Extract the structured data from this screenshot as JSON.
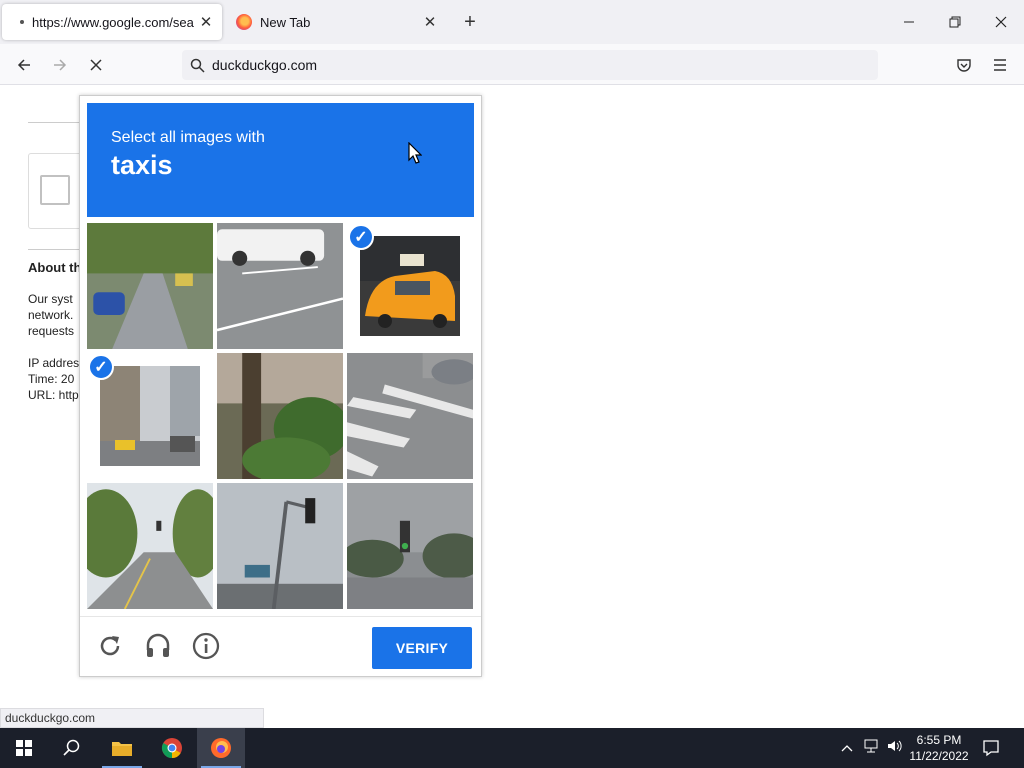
{
  "browser": {
    "tabs": [
      {
        "title": "https://www.google.com/search?q=",
        "active": true
      },
      {
        "title": "New Tab",
        "active": false
      }
    ],
    "new_tab_glyph": "+",
    "url": "duckduckgo.com",
    "status_bar": "duckduckgo.com"
  },
  "background_page": {
    "heading": "About th",
    "paragraph_lines": [
      "Our syst",
      "network.",
      "requests"
    ],
    "info_lines": [
      "IP addres",
      "Time: 20",
      "URL: http"
    ]
  },
  "captcha": {
    "instruction": "Select all images with",
    "keyword": "taxis",
    "tiles": [
      {
        "scene": "tree-lined-street",
        "selected": false
      },
      {
        "scene": "white-pickup-truck",
        "selected": false
      },
      {
        "scene": "yellow-taxi",
        "selected": true
      },
      {
        "scene": "city-street-taxi",
        "selected": true
      },
      {
        "scene": "tree-and-bushes",
        "selected": false
      },
      {
        "scene": "crosswalk",
        "selected": false
      },
      {
        "scene": "road-with-traffic-light",
        "selected": false
      },
      {
        "scene": "traffic-light-pole",
        "selected": false
      },
      {
        "scene": "traffic-light-cloudy",
        "selected": false
      }
    ],
    "verify_label": "VERIFY",
    "accent": "#1a73e8",
    "icons": [
      "reload-icon",
      "audio-icon",
      "info-icon"
    ]
  },
  "taskbar": {
    "apps": [
      "start",
      "search",
      "file-explorer",
      "chrome",
      "firefox"
    ],
    "active_app": "firefox",
    "time": "6:55 PM",
    "date": "11/22/2022"
  }
}
